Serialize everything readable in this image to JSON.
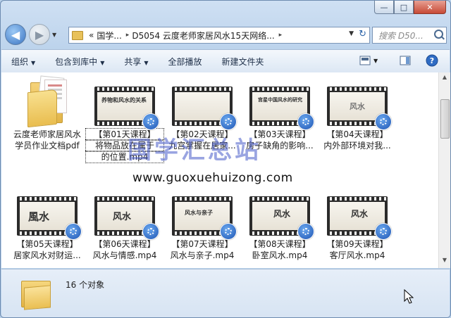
{
  "window": {
    "caption_minimize": "—",
    "caption_maximize": "□",
    "caption_close": "✕"
  },
  "address": {
    "prefix": "«",
    "crumb1": "国学...",
    "crumb2": "D5054 云度老师家居风水15天网络...",
    "sep": "▸"
  },
  "search": {
    "placeholder": "搜索 D50..."
  },
  "toolbar": {
    "organize": "组织",
    "include_in_library": "包含到库中",
    "share": "共享",
    "play_all": "全部播放",
    "new_folder": "新建文件夹"
  },
  "files": [
    {
      "line1": "云度老师家居风水",
      "line2": "学员作业文档pdf",
      "kind": "folder"
    },
    {
      "line1": "【第01天课程】",
      "line2": "将物品放在属于",
      "line3": "的位置.mp4",
      "kind": "video",
      "ink": "养物和风水的关系"
    },
    {
      "line1": "【第02天课程】",
      "line2": "九宫掌握在居家...",
      "kind": "video",
      "ink": ""
    },
    {
      "line1": "【第03天课程】",
      "line2": "房子缺角的影响...",
      "kind": "video",
      "ink": "宫星中国风水的研究"
    },
    {
      "line1": "【第04天课程】",
      "line2": "内外部环境对我...",
      "kind": "video",
      "ink": "风水"
    },
    {
      "line1": "【第05天课程】",
      "line2": "居家风水对财运...",
      "kind": "video",
      "ink": "風水"
    },
    {
      "line1": "【第06天课程】",
      "line2": "风水与情感.mp4",
      "kind": "video",
      "ink": "风水"
    },
    {
      "line1": "【第07天课程】",
      "line2": "风水与亲子.mp4",
      "kind": "video",
      "ink": "风水与亲子"
    },
    {
      "line1": "【第08天课程】",
      "line2": "卧室风水.mp4",
      "kind": "video",
      "ink": "风水"
    },
    {
      "line1": "【第09天课程】",
      "line2": "客厅风水.mp4",
      "kind": "video",
      "ink": "风水"
    }
  ],
  "watermark": {
    "title": "国学汇总站",
    "url": "www.guoxuehuizong.com"
  },
  "details": {
    "count": "16 个对象"
  }
}
